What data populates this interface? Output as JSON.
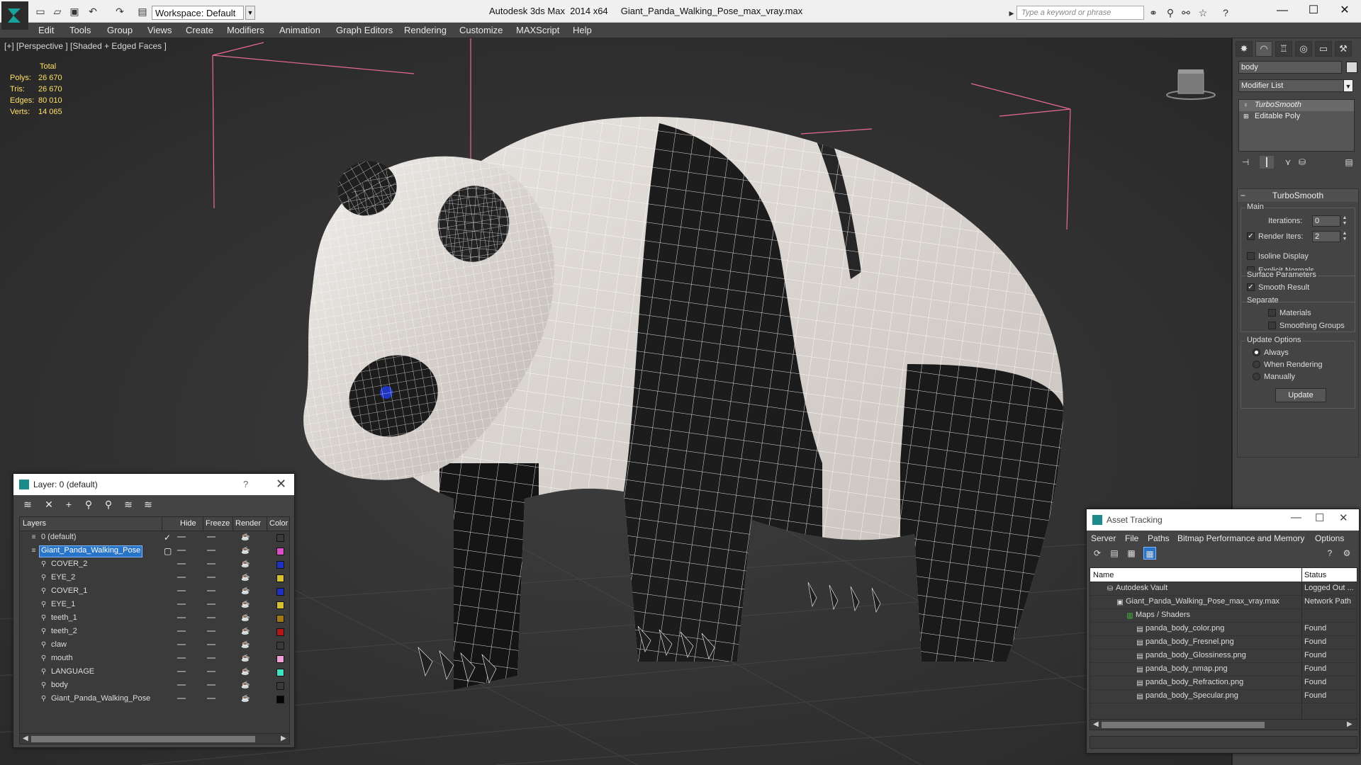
{
  "titlebar": {
    "app_title": "Autodesk 3ds Max  2014 x64     Giant_Panda_Walking_Pose_max_vray.max",
    "workspace": "Workspace: Default",
    "search_placeholder": "Type a keyword or phrase"
  },
  "menu": [
    "Edit",
    "Tools",
    "Group",
    "Views",
    "Create",
    "Modifiers",
    "Animation",
    "Graph Editors",
    "Rendering",
    "Customize",
    "MAXScript",
    "Help"
  ],
  "viewport": {
    "label": "[+] [Perspective ] [Shaded + Edged Faces ]",
    "stats_header": "Total",
    "stats": [
      {
        "label": "Polys:",
        "value": "26 670"
      },
      {
        "label": "Tris:",
        "value": "26 670"
      },
      {
        "label": "Edges:",
        "value": "80 010"
      },
      {
        "label": "Verts:",
        "value": "14 065"
      }
    ]
  },
  "command_panel": {
    "object_name": "body",
    "modifier_list": "Modifier List",
    "stack": [
      "TurboSmooth",
      "Editable Poly"
    ],
    "rollout_title": "TurboSmooth",
    "main_group": "Main",
    "iterations_label": "Iterations:",
    "iterations_value": "0",
    "render_iters_label": "Render Iters:",
    "render_iters_value": "2",
    "isoline_label": "Isoline Display",
    "explicit_normals_label": "Explicit Normals",
    "surface_group": "Surface Parameters",
    "smooth_result_label": "Smooth Result",
    "separate_label": "Separate",
    "materials_label": "Materials",
    "smoothing_groups_label": "Smoothing Groups",
    "update_group": "Update Options",
    "always_label": "Always",
    "when_rendering_label": "When Rendering",
    "manually_label": "Manually",
    "update_button": "Update"
  },
  "layer_dialog": {
    "title": "Layer: 0 (default)",
    "help": "?",
    "columns": [
      "Layers",
      "Hide",
      "Freeze",
      "Render",
      "Color"
    ],
    "rows": [
      {
        "name": "0 (default)",
        "color": "#3a3a3a",
        "level": 0
      },
      {
        "name": "Giant_Panda_Walking_Pose",
        "color": "#d94fc8",
        "level": 0
      },
      {
        "name": "COVER_2",
        "color": "#2030c0",
        "level": 1
      },
      {
        "name": "EYE_2",
        "color": "#d4c030",
        "level": 1
      },
      {
        "name": "COVER_1",
        "color": "#2030c0",
        "level": 1
      },
      {
        "name": "EYE_1",
        "color": "#d4c030",
        "level": 1
      },
      {
        "name": "teeth_1",
        "color": "#a07818",
        "level": 1
      },
      {
        "name": "teeth_2",
        "color": "#b01818",
        "level": 1
      },
      {
        "name": "claw",
        "color": "#3a3a3a",
        "level": 1
      },
      {
        "name": "mouth",
        "color": "#f0a0d8",
        "level": 1
      },
      {
        "name": "LANGUAGE",
        "color": "#40e0c0",
        "level": 1
      },
      {
        "name": "body",
        "color": "#3a3a3a",
        "level": 1
      },
      {
        "name": "Giant_Panda_Walking_Pose",
        "color": "#050505",
        "level": 1
      }
    ]
  },
  "asset_dialog": {
    "title": "Asset Tracking",
    "menu": [
      "Server",
      "File",
      "Paths",
      "Bitmap Performance and Memory",
      "Options"
    ],
    "columns": [
      "Name",
      "Status"
    ],
    "rows": [
      {
        "name": "Autodesk Vault",
        "status": "Logged Out ...",
        "level": 0
      },
      {
        "name": "Giant_Panda_Walking_Pose_max_vray.max",
        "status": "Network Path",
        "level": 1
      },
      {
        "name": "Maps / Shaders",
        "status": "",
        "level": 2
      },
      {
        "name": "panda_body_color.png",
        "status": "Found",
        "level": 3
      },
      {
        "name": "panda_body_Fresnel.png",
        "status": "Found",
        "level": 3
      },
      {
        "name": "panda_body_Glossiness.png",
        "status": "Found",
        "level": 3
      },
      {
        "name": "panda_body_nmap.png",
        "status": "Found",
        "level": 3
      },
      {
        "name": "panda_body_Refraction.png",
        "status": "Found",
        "level": 3
      },
      {
        "name": "panda_body_Specular.png",
        "status": "Found",
        "level": 3
      }
    ]
  }
}
